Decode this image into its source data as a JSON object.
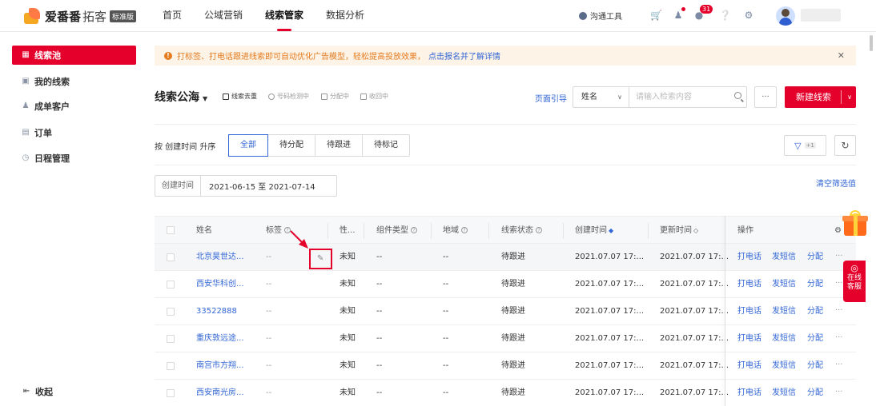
{
  "header": {
    "logo_name": "爱番番",
    "logo_sub": "拓客",
    "logo_badge": "标准版",
    "nav": [
      "首页",
      "公域营销",
      "线索管家",
      "数据分析"
    ],
    "active_nav": 2,
    "tool_label": "沟通工具",
    "notification_count": "31"
  },
  "sidebar": {
    "items": [
      {
        "label": "线索池",
        "icon": "grid-icon",
        "active": true
      },
      {
        "label": "我的线索",
        "icon": "folder-icon"
      },
      {
        "label": "成单客户",
        "icon": "user-icon"
      },
      {
        "label": "订单",
        "icon": "list-icon"
      },
      {
        "label": "日程管理",
        "icon": "clock-icon"
      }
    ],
    "collapse_label": "收起"
  },
  "notice": {
    "text": "打标签、打电话跟进线索即可自动优化广告模型，轻松提高投放效果，",
    "link": "点击报名并了解详情"
  },
  "toolbar": {
    "title": "线索公海",
    "actions": [
      "线索去重",
      "号码检测中",
      "分配中",
      "收回中"
    ],
    "guide": "页面引导",
    "search_field": "姓名",
    "search_placeholder": "请输入检索内容",
    "more": "...",
    "new_button": "新建线索"
  },
  "filters": {
    "sort_label": "按 创建时间 升序",
    "tabs": [
      "全部",
      "待分配",
      "待跟进",
      "待标记"
    ],
    "active_tab": 0,
    "filter_count": "+1",
    "date_label": "创建时间",
    "date_range": "2021-06-15 至 2021-07-14",
    "clear_label": "清空筛选值"
  },
  "table": {
    "columns": [
      "姓名",
      "标签",
      "性...",
      "组件类型",
      "地域",
      "线索状态",
      "创建时间",
      "更新时间",
      "操作"
    ],
    "rows": [
      {
        "name": "北京昊世达...",
        "tag": "--",
        "gender": "未知",
        "component": "--",
        "region": "--",
        "status": "待跟进",
        "created": "2021.07.07 17:...",
        "updated": "2021.07.07 17:..."
      },
      {
        "name": "西安华科创...",
        "tag": "--",
        "gender": "未知",
        "component": "--",
        "region": "--",
        "status": "待跟进",
        "created": "2021.07.07 17:...",
        "updated": "2021.07.07 17:..."
      },
      {
        "name": "33522888",
        "tag": "--",
        "gender": "未知",
        "component": "--",
        "region": "--",
        "status": "待跟进",
        "created": "2021.07.07 17:...",
        "updated": "2021.07.07 17:..."
      },
      {
        "name": "重庆敦远途...",
        "tag": "--",
        "gender": "未知",
        "component": "--",
        "region": "--",
        "status": "待跟进",
        "created": "2021.07.07 17:...",
        "updated": "2021.07.07 17:..."
      },
      {
        "name": "南宫市方翔...",
        "tag": "--",
        "gender": "未知",
        "component": "--",
        "region": "--",
        "status": "待跟进",
        "created": "2021.07.07 17:...",
        "updated": "2021.07.07 17:..."
      },
      {
        "name": "西安南光房...",
        "tag": "--",
        "gender": "未知",
        "component": "--",
        "region": "--",
        "status": "待跟进",
        "created": "2021.07.07 17:...",
        "updated": "2021.07.07 17:..."
      }
    ],
    "ops": [
      "打电话",
      "发短信",
      "分配"
    ],
    "more": "···"
  },
  "service": {
    "line1": "在线",
    "line2": "客服"
  }
}
